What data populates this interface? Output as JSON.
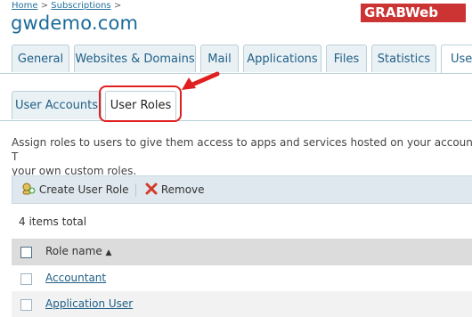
{
  "breadcrumb": {
    "home": "Home",
    "sep": ">",
    "subscriptions": "Subscriptions",
    "tail": ">"
  },
  "page_title": "gwdemo.com",
  "logo": {
    "part1": "GRAB",
    "part2": "Web"
  },
  "tabs": [
    {
      "label": "General"
    },
    {
      "label": "Websites & Domains"
    },
    {
      "label": "Mail"
    },
    {
      "label": "Applications"
    },
    {
      "label": "Files"
    },
    {
      "label": "Statistics"
    },
    {
      "label": "User"
    }
  ],
  "subtabs": [
    {
      "label": "User Accounts"
    },
    {
      "label": "User Roles"
    }
  ],
  "description": {
    "line1": "Assign roles to users to give them access to apps and services hosted on your account. T",
    "line2": "your own custom roles."
  },
  "toolbar": {
    "create_label": "Create User Role",
    "remove_label": "Remove"
  },
  "items_total": "4 items total",
  "table": {
    "column_role_name": "Role name",
    "sort_indicator": "▲",
    "rows": [
      {
        "name": "Accountant"
      },
      {
        "name": "Application User"
      }
    ]
  },
  "colors": {
    "accent": "#1f5f86",
    "highlight": "#e02020",
    "logo_bg": "#cc3333"
  },
  "icons": [
    "create-role-icon",
    "remove-x-icon",
    "red-arrow-icon"
  ]
}
